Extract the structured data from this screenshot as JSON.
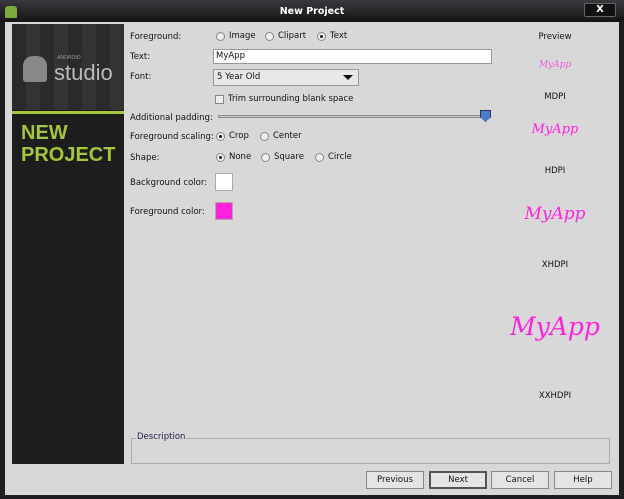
{
  "window": {
    "title": "New Project",
    "close_label": "X"
  },
  "sidebar": {
    "logo_small": "ANDROID",
    "logo_big": "studio",
    "heading_line1": "NEW",
    "heading_line2": "PROJECT"
  },
  "form": {
    "foreground_label": "Foreground:",
    "foreground_options": [
      "Image",
      "Clipart",
      "Text"
    ],
    "foreground_selected": "Text",
    "text_label": "Text:",
    "text_value": "MyApp",
    "font_label": "Font:",
    "font_value": "5 Year Old",
    "trim_label": "Trim surrounding blank space",
    "trim_checked": false,
    "padding_label": "Additional padding:",
    "padding_percent": 100,
    "scaling_label": "Foreground scaling:",
    "scaling_options": [
      "Crop",
      "Center"
    ],
    "scaling_selected": "Crop",
    "shape_label": "Shape:",
    "shape_options": [
      "None",
      "Square",
      "Circle"
    ],
    "shape_selected": "None",
    "bg_color_label": "Background color:",
    "bg_color": "#ffffff",
    "fg_color_label": "Foreground color:",
    "fg_color": "#ff22dd"
  },
  "preview": {
    "title": "Preview",
    "sample": "MyApp",
    "densities": [
      "MDPI",
      "HDPI",
      "XHDPI",
      "XXHDPI"
    ]
  },
  "description": {
    "label": "Description"
  },
  "buttons": {
    "previous": "Previous",
    "next": "Next",
    "cancel": "Cancel",
    "help": "Help"
  }
}
